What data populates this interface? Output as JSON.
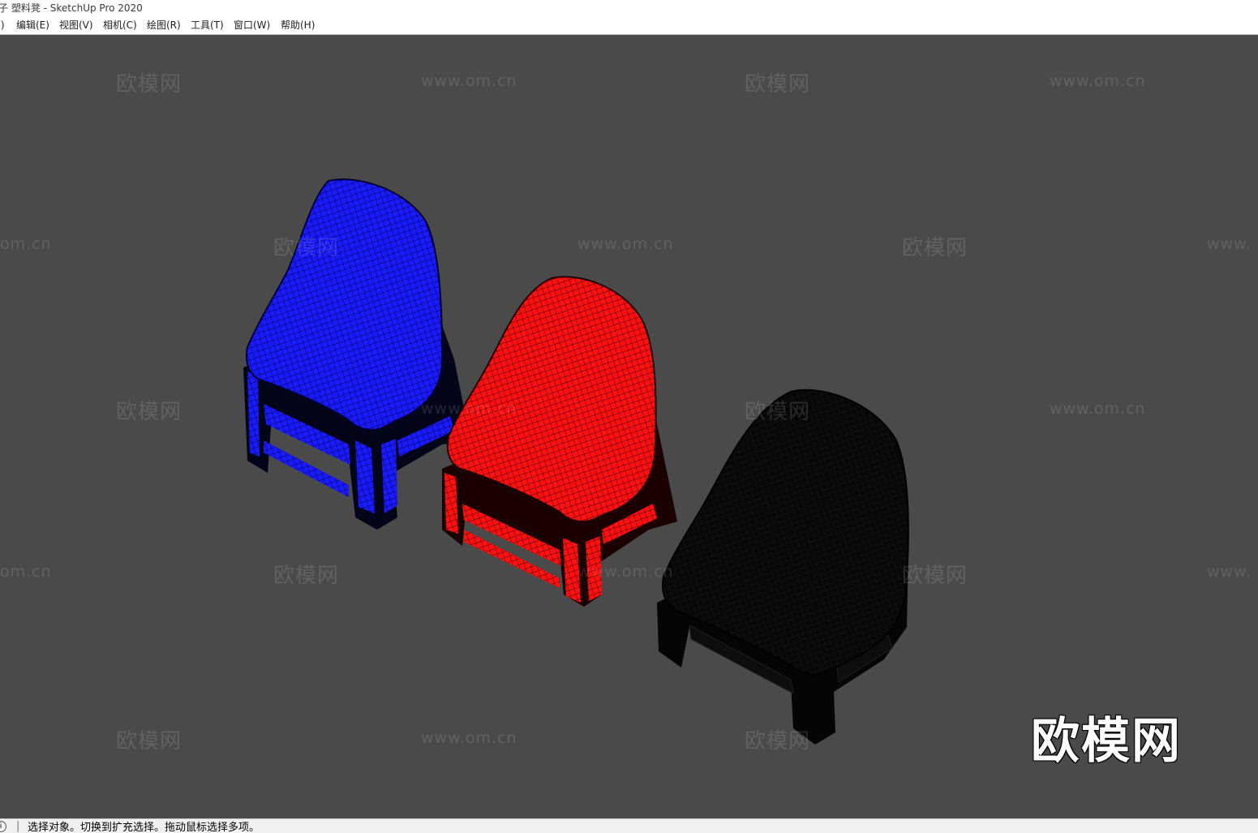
{
  "window": {
    "title": "子 塑料凳 - SketchUp Pro 2020"
  },
  "menu": {
    "items": [
      {
        "label": "F)"
      },
      {
        "label": "编辑(E)"
      },
      {
        "label": "视图(V)"
      },
      {
        "label": "相机(C)"
      },
      {
        "label": "绘图(R)"
      },
      {
        "label": "工具(T)"
      },
      {
        "label": "窗口(W)"
      },
      {
        "label": "帮助(H)"
      }
    ]
  },
  "viewport": {
    "background": "#4a4a4a",
    "models": [
      {
        "name": "blue-stool",
        "color": "#1a1aff"
      },
      {
        "name": "red-stool",
        "color": "#ff1010"
      },
      {
        "name": "black-stool",
        "color": "#060606"
      }
    ],
    "watermarks": {
      "brand": "欧模网",
      "url": "www.om.cn",
      "url_cut": "om.cn",
      "url_cut_right": "www."
    },
    "logo_watermark": "欧模网"
  },
  "status": {
    "icon": "info-icon",
    "separator": "|",
    "text": "选择对象。切换到扩充选择。拖动鼠标选择多项。"
  }
}
